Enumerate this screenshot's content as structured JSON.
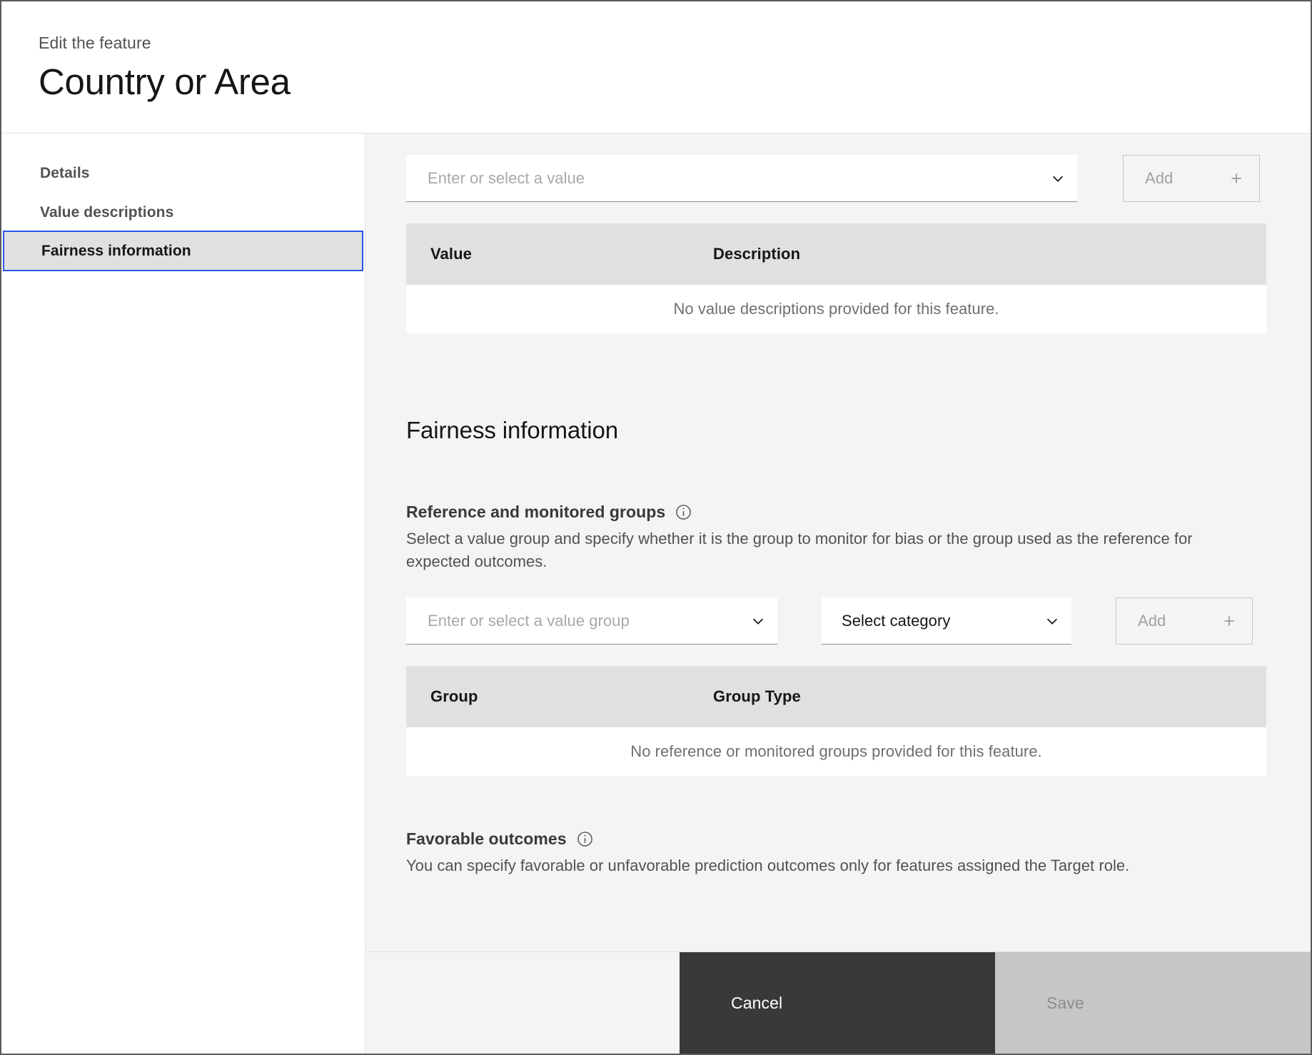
{
  "header": {
    "eyebrow": "Edit the feature",
    "title": "Country or Area"
  },
  "sidebar": {
    "items": [
      {
        "label": "Details",
        "selected": false
      },
      {
        "label": "Value descriptions",
        "selected": false
      },
      {
        "label": "Fairness information",
        "selected": true
      }
    ]
  },
  "value_descriptions": {
    "value_input": {
      "placeholder": "Enter or select a value",
      "value": ""
    },
    "add_button": {
      "label": "Add",
      "icon": "plus-icon",
      "disabled": true
    },
    "table": {
      "columns": [
        "Value",
        "Description"
      ],
      "rows": [],
      "empty_message": "No value descriptions provided for this feature."
    }
  },
  "fairness": {
    "section_title": "Fairness information",
    "reference_groups": {
      "label": "Reference and monitored groups",
      "info_icon": "info-icon",
      "help": "Select a value group and specify whether it is the group to monitor for bias or the group used as the reference for expected outcomes.",
      "group_input": {
        "placeholder": "Enter or select a value group",
        "value": ""
      },
      "category_select": {
        "value": "Select category"
      },
      "add_button": {
        "label": "Add",
        "icon": "plus-icon",
        "disabled": true
      },
      "table": {
        "columns": [
          "Group",
          "Group Type"
        ],
        "rows": [],
        "empty_message": "No reference or monitored groups provided for this feature."
      }
    },
    "favorable_outcomes": {
      "label": "Favorable outcomes",
      "info_icon": "info-icon",
      "help": "You can specify favorable or unfavorable prediction outcomes only for features assigned the Target role."
    }
  },
  "footer": {
    "cancel_label": "Cancel",
    "save_label": "Save",
    "save_disabled": true
  },
  "colors": {
    "accent_blue": "#2c56e8",
    "page_bg": "#f4f4f4",
    "panel_white": "#ffffff",
    "table_header": "#e0e0e0",
    "cancel_bg": "#393939",
    "save_bg": "#c6c6c6",
    "text_primary": "#161616",
    "text_secondary": "#525252",
    "placeholder": "#a8a8a8"
  }
}
